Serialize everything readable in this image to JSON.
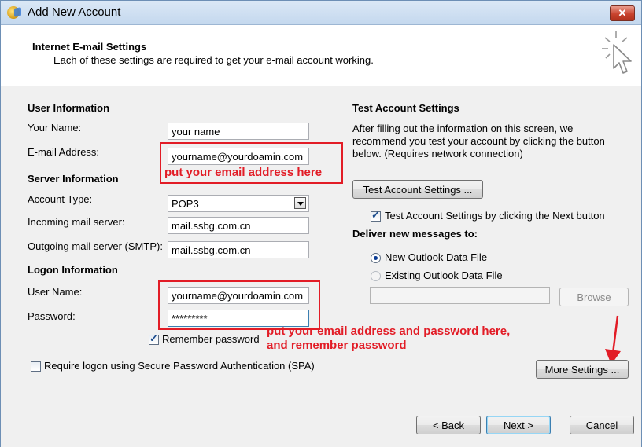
{
  "window": {
    "title": "Add New Account",
    "close_glyph": "✕"
  },
  "header": {
    "title": "Internet E-mail Settings",
    "subtitle": "Each of these settings are required to get your e-mail account working."
  },
  "user_information": {
    "heading": "User Information",
    "your_name_label": "Your Name:",
    "your_name_value": "your  name",
    "email_label": "E-mail Address:",
    "email_value": "yourname@yourdoamin.com"
  },
  "server_information": {
    "heading": "Server Information",
    "account_type_label": "Account Type:",
    "account_type_value": "POP3",
    "incoming_label": "Incoming mail server:",
    "incoming_value": "mail.ssbg.com.cn",
    "outgoing_label": "Outgoing mail server (SMTP):",
    "outgoing_value": "mail.ssbg.com.cn"
  },
  "logon_information": {
    "heading": "Logon Information",
    "user_name_label": "User Name:",
    "user_name_value": "yourname@yourdoamin.com",
    "password_label": "Password:",
    "password_value": "*********",
    "remember_label": "Remember password",
    "remember_checked": true,
    "spa_label": "Require logon using Secure Password Authentication (SPA)",
    "spa_checked": false
  },
  "test_settings": {
    "heading": "Test Account Settings",
    "description_line1": "After filling out the information on this screen, we",
    "description_line2": "recommend you test your account by clicking the button",
    "description_line3": "below. (Requires network connection)",
    "test_button": "Test Account Settings ...",
    "next_checkbox_label": "Test Account Settings by clicking the Next button",
    "next_checkbox_checked": true
  },
  "delivery": {
    "heading": "Deliver new messages to:",
    "options": [
      {
        "label": "New Outlook Data File",
        "selected": true
      },
      {
        "label": "Existing Outlook Data File",
        "selected": false
      }
    ],
    "path_value": "",
    "browse_button": "Browse"
  },
  "more_settings_button": "More Settings ...",
  "annotations": {
    "email_note": "put your email address here",
    "logon_note_line1": "put your email address and password here,",
    "logon_note_line2": "and remember password",
    "color": "#e21c26"
  },
  "footer": {
    "back_button": "< Back",
    "next_button": "Next >",
    "cancel_button": "Cancel"
  },
  "icons": [
    "outlook-app-icon",
    "close-icon",
    "mouse-cursor-icon",
    "chevron-down-icon",
    "red-arrow-icon"
  ]
}
